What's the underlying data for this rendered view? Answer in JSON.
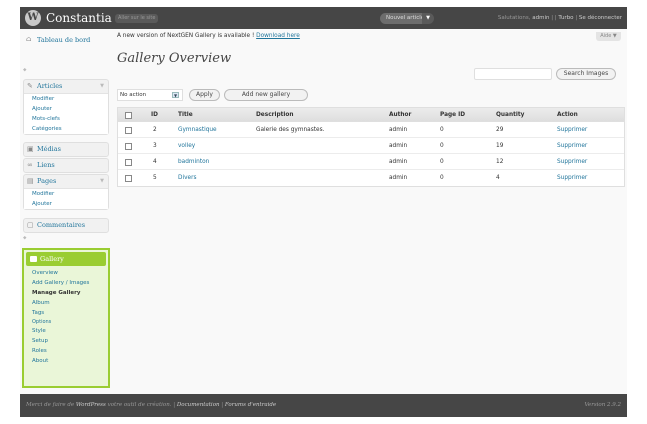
{
  "header": {
    "site_title": "Constantia",
    "visit_site": "Aller sur le site",
    "new_post": "Nouvel article",
    "greeting": "Salutations,",
    "user": "admin",
    "turbo": "Turbo",
    "logout": "Se déconnecter",
    "separators": "| |",
    "separator2": "|"
  },
  "sidebar": {
    "dashboard": "Tableau de bord",
    "articles": {
      "label": "Articles",
      "items": [
        "Modifier",
        "Ajouter",
        "Mots-clefs",
        "Catégories"
      ]
    },
    "media": "Médias",
    "links": "Liens",
    "pages": {
      "label": "Pages",
      "items": [
        "Modifier",
        "Ajouter"
      ]
    },
    "comments": "Commentaires",
    "gallery": {
      "label": "Gallery",
      "items": [
        "Overview",
        "Add Gallery / Images",
        "Manage Gallery",
        "Album",
        "Tags",
        "Options",
        "Style",
        "Setup",
        "Roles",
        "About"
      ]
    }
  },
  "main": {
    "notice_text": "A new version of NextGEN Gallery is available !",
    "notice_link": "Download here",
    "help": "Aide",
    "title": "Gallery Overview",
    "search_button": "Search Images",
    "search_placeholder": "",
    "bulk_action": "No action",
    "apply": "Apply",
    "add_gallery": "Add new gallery"
  },
  "table": {
    "columns": [
      "ID",
      "Title",
      "Description",
      "Author",
      "Page ID",
      "Quantity",
      "Action"
    ],
    "rows": [
      {
        "id": "2",
        "title": "Gymnastique",
        "description": "Galerie des gymnastes.",
        "author": "admin",
        "page_id": "0",
        "quantity": "29",
        "action": "Supprimer"
      },
      {
        "id": "3",
        "title": "volley",
        "description": "",
        "author": "admin",
        "page_id": "0",
        "quantity": "19",
        "action": "Supprimer"
      },
      {
        "id": "4",
        "title": "badminton",
        "description": "",
        "author": "admin",
        "page_id": "0",
        "quantity": "12",
        "action": "Supprimer"
      },
      {
        "id": "5",
        "title": "Divers",
        "description": "",
        "author": "admin",
        "page_id": "0",
        "quantity": "4",
        "action": "Supprimer"
      }
    ]
  },
  "footer": {
    "thanks_prefix": "Merci de faire de",
    "wordpress": "WordPress",
    "thanks_suffix": "votre outil de création. |",
    "documentation": "Documentation",
    "pipe": "|",
    "forums": "Forums d'entraide",
    "version": "Version 2.9.2"
  },
  "colors": {
    "header_bg": "#464646",
    "link": "#21759b",
    "gallery_highlight": "#9acd32"
  }
}
